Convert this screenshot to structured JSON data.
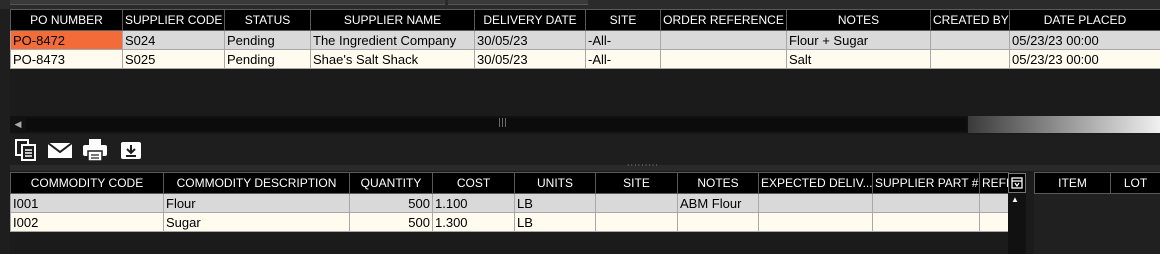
{
  "po_grid": {
    "columns": [
      "PO NUMBER",
      "SUPPLIER CODE",
      "STATUS",
      "SUPPLIER NAME",
      "DELIVERY DATE",
      "SITE",
      "ORDER REFERENCE",
      "NOTES",
      "CREATED BY",
      "DATE PLACED"
    ],
    "rows": [
      [
        "PO-8472",
        "S024",
        "Pending",
        "The Ingredient Company",
        "30/05/23",
        "-All-",
        "",
        "Flour + Sugar",
        "",
        "05/23/23 00:00"
      ],
      [
        "PO-8473",
        "S025",
        "Pending",
        "Shae's Salt Shack",
        "30/05/23",
        "-All-",
        "",
        "Salt",
        "",
        "05/23/23 00:00"
      ]
    ],
    "selected_cell": "PO-8472"
  },
  "toolbar": {
    "icons": [
      "copy-icon",
      "email-icon",
      "print-icon",
      "download-icon"
    ]
  },
  "line_grid": {
    "columns": [
      "COMMODITY CODE",
      "COMMODITY DESCRIPTION",
      "QUANTITY",
      "COST",
      "UNITS",
      "SITE",
      "NOTES",
      "EXPECTED DELIV...",
      "SUPPLIER PART #",
      "REFE"
    ],
    "rows": [
      [
        "I001",
        "Flour",
        "500",
        "1.100",
        "LB",
        "",
        "ABM Flour",
        "",
        "",
        ""
      ],
      [
        "I002",
        "Sugar",
        "500",
        "1.300",
        "LB",
        "",
        "",
        "",
        "",
        ""
      ]
    ]
  },
  "side_grid": {
    "columns": [
      "ITEM",
      "LOT"
    ]
  },
  "colors": {
    "selected": "#f26b38",
    "header_bg": "#000000",
    "row_odd": "#d9d9d9",
    "row_even": "#fffbee"
  }
}
